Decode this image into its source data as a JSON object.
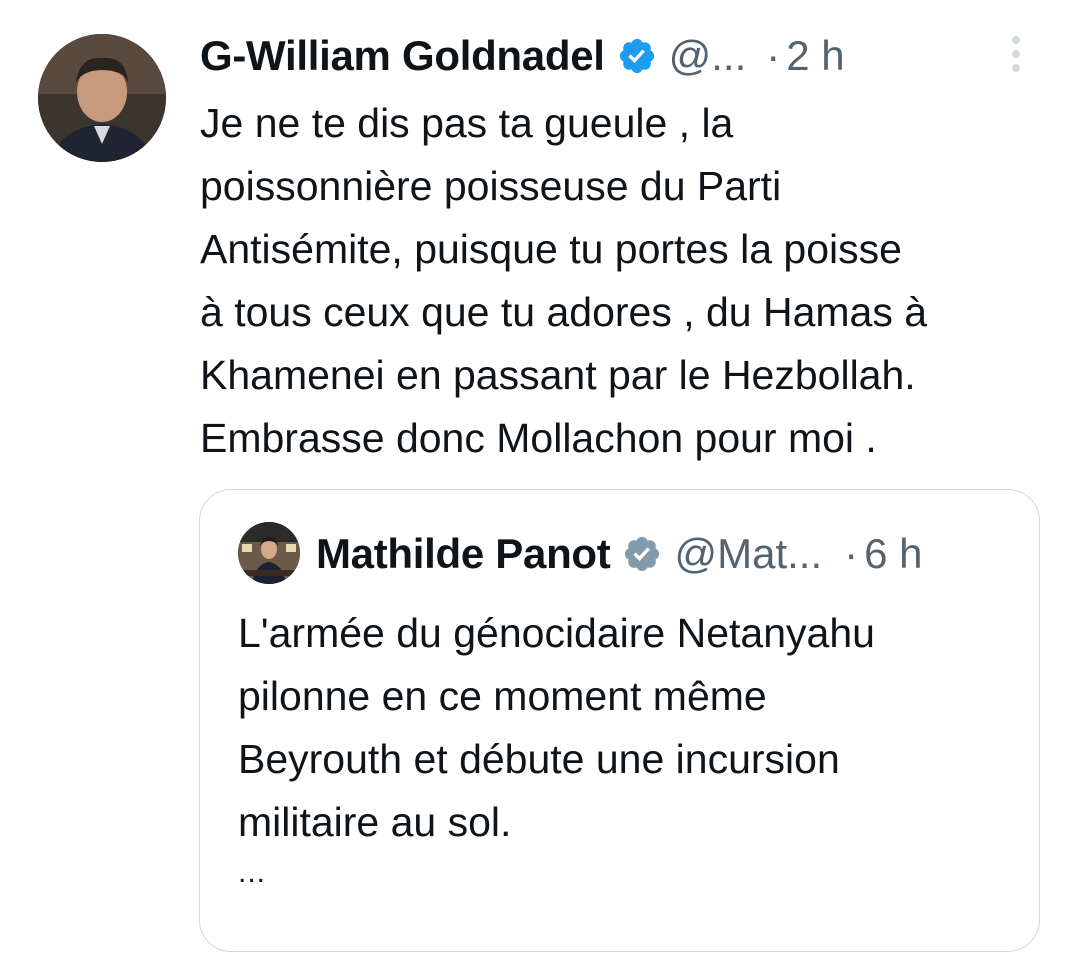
{
  "tweet": {
    "author": {
      "name": "G-William Goldnadel",
      "handle": "@...",
      "verified": true,
      "avatar_icon": "user-photo-avatar"
    },
    "separator": "·",
    "time": "2 h",
    "more_icon": "more-vertical-icon",
    "text": "Je ne te dis pas ta gueule , la\npoissonnière poisseuse du Parti\nAntisémite, puisque tu portes la poisse\nà tous ceux que tu adores , du Hamas à\nKhamenei en passant par le Hezbollah.\nEmbrasse donc Mollachon pour moi ."
  },
  "quoted_tweet": {
    "author": {
      "name": "Mathilde Panot",
      "handle": "@Mat...",
      "verified": true,
      "verified_color": "#829aab",
      "avatar_icon": "user-photo-avatar"
    },
    "separator": "·",
    "time": "6 h",
    "text": "L'armée du génocidaire Netanyahu\npilonne en ce moment même\nBeyrouth et débute une incursion\nmilitaire au sol.",
    "truncation": "..."
  },
  "colors": {
    "verified_blue": "#1d9bf0",
    "verified_gray": "#829aab",
    "text_primary": "#0f1419",
    "text_secondary": "#536471",
    "border": "#cfd9de"
  }
}
